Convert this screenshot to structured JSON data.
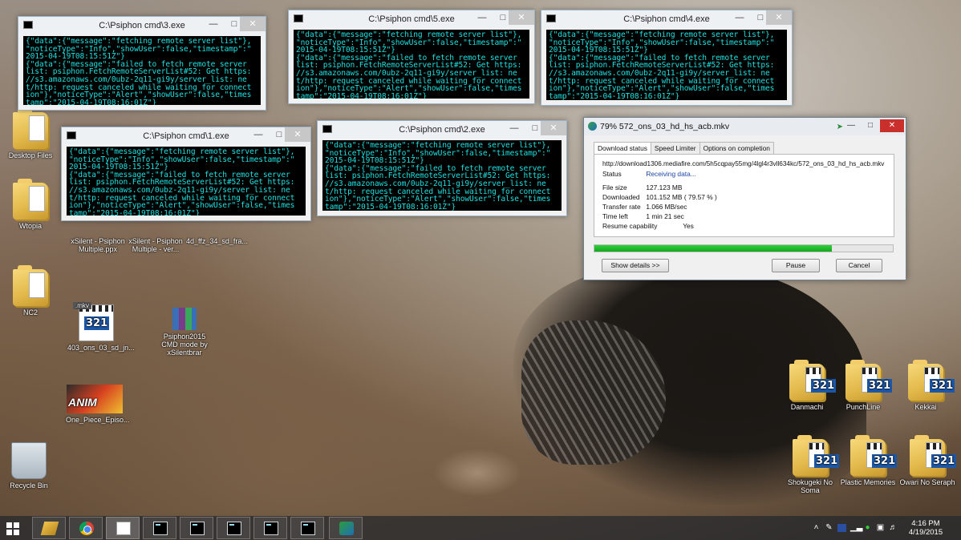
{
  "desktop": {
    "icons_left": [
      {
        "id": "desktop-files",
        "label": "Desktop Files",
        "type": "folder"
      },
      {
        "id": "wtopia",
        "label": "Wtopia",
        "type": "folder"
      },
      {
        "id": "nc2",
        "label": "NC2",
        "type": "folder"
      },
      {
        "id": "recycle-bin",
        "label": "Recycle Bin",
        "type": "recycle"
      },
      {
        "id": "mkv-file",
        "label": "403_ons_03_sd_jn...",
        "badge": ".mkv",
        "type": "mpc"
      },
      {
        "id": "psiphon-cmd",
        "label": "Psiphon2015 CMD mode by xSilentbrar",
        "type": "winrar"
      },
      {
        "id": "one-piece",
        "label": "One_Piece_Episo...",
        "type": "anim"
      },
      {
        "id": "xsilent-1",
        "label": "xSilent - Psiphon Multiple.ppx",
        "type": "exe"
      },
      {
        "id": "xsilent-2",
        "label": "xSilent - Psiphon Multiple - ver...",
        "type": "exe"
      },
      {
        "id": "file-4",
        "label": "4d_ffz_34_sd_fra...",
        "type": "mpc"
      }
    ],
    "icons_right": [
      {
        "id": "danmachi",
        "label": "Danmachi"
      },
      {
        "id": "punchline",
        "label": "PunchLine"
      },
      {
        "id": "kekkai",
        "label": "Kekkai"
      },
      {
        "id": "shokugeki",
        "label": "Shokugeki No Soma"
      },
      {
        "id": "plastic-memories",
        "label": "Plastic Memories"
      },
      {
        "id": "owari",
        "label": "Owari No Seraph"
      }
    ]
  },
  "consoles": [
    {
      "title": "C:\\Psiphon cmd\\3.exe",
      "lines": [
        "{\"data\":{\"message\":\"fetching remote server list\"},",
        "\"noticeType\":\"Info\",\"showUser\":false,\"timestamp\":\"",
        "2015-04-19T08:15:51Z\"}",
        "{\"data\":{\"message\":\"failed to fetch remote server",
        "list: psiphon.FetchRemoteServerList#52: Get https:",
        "//s3.amazonaws.com/0ubz-2q11-gi9y/server_list: ne",
        "t/http: request canceled while waiting for connect",
        "ion\"},\"noticeType\":\"Alert\",\"showUser\":false,\"times",
        "tamp\":\"2015-04-19T08:16:01Z\"}"
      ]
    },
    {
      "title": "C:\\Psiphon cmd\\5.exe",
      "lines": [
        "{\"data\":{\"message\":\"fetching remote server list\"},",
        "\"noticeType\":\"Info\",\"showUser\":false,\"timestamp\":\"",
        "2015-04-19T08:15:51Z\"}",
        "{\"data\":{\"message\":\"failed to fetch remote server",
        "list: psiphon.FetchRemoteServerList#52: Get https:",
        "//s3.amazonaws.com/0ubz-2q11-gi9y/server_list: ne",
        "t/http: request canceled while waiting for connect",
        "ion\"},\"noticeType\":\"Alert\",\"showUser\":false,\"times",
        "tamp\":\"2015-04-19T08:16:01Z\"}"
      ]
    },
    {
      "title": "C:\\Psiphon cmd\\4.exe",
      "lines": [
        "{\"data\":{\"message\":\"fetching remote server list\"},",
        "\"noticeType\":\"Info\",\"showUser\":false,\"timestamp\":\"",
        "2015-04-19T08:15:51Z\"}",
        "{\"data\":{\"message\":\"failed to fetch remote server",
        "list: psiphon.FetchRemoteServerList#52: Get https:",
        "//s3.amazonaws.com/0ubz-2q11-gi9y/server_list: ne",
        "t/http: request canceled while waiting for connect",
        "ion\"},\"noticeType\":\"Alert\",\"showUser\":false,\"times",
        "tamp\":\"2015-04-19T08:16:01Z\"}"
      ]
    },
    {
      "title": "C:\\Psiphon cmd\\1.exe",
      "lines": [
        "{\"data\":{\"message\":\"fetching remote server list\"},",
        "\"noticeType\":\"Info\",\"showUser\":false,\"timestamp\":\"",
        "2015-04-19T08:15:51Z\"}",
        "{\"data\":{\"message\":\"failed to fetch remote server",
        "list: psiphon.FetchRemoteServerList#52: Get https:",
        "//s3.amazonaws.com/0ubz-2q11-gi9y/server_list: ne",
        "t/http: request canceled while waiting for connect",
        "ion\"},\"noticeType\":\"Alert\",\"showUser\":false,\"times",
        "tamp\":\"2015-04-19T08:16:01Z\"}"
      ]
    },
    {
      "title": "C:\\Psiphon cmd\\2.exe",
      "lines": [
        "{\"data\":{\"message\":\"fetching remote server list\"},",
        "\"noticeType\":\"Info\",\"showUser\":false,\"timestamp\":\"",
        "2015-04-19T08:15:51Z\"}",
        "{\"data\":{\"message\":\"failed to fetch remote server",
        "list: psiphon.FetchRemoteServerList#52: Get https:",
        "//s3.amazonaws.com/0ubz-2q11-gi9y/server_list: ne",
        "t/http: request canceled while waiting for connect",
        "ion\"},\"noticeType\":\"Alert\",\"showUser\":false,\"times",
        "tamp\":\"2015-04-19T08:16:01Z\"}"
      ]
    }
  ],
  "download": {
    "title": "79% 572_ons_03_hd_hs_acb.mkv",
    "tabs": [
      "Download status",
      "Speed Limiter",
      "Options on completion"
    ],
    "url": "http://download1306.mediafire.com/5h5cqpay55mg/4lgl4r3vll634kc/572_ons_03_hd_hs_acb.mkv",
    "status_label": "Status",
    "status_value": "Receiving data...",
    "rows": [
      {
        "label": "File size",
        "value": "127.123  MB"
      },
      {
        "label": "Downloaded",
        "value": "101.152  MB  ( 79.57 % )"
      },
      {
        "label": "Transfer rate",
        "value": "1.066  MB/sec"
      },
      {
        "label": "Time left",
        "value": "1 min 21 sec"
      },
      {
        "label": "Resume capability",
        "value": "Yes"
      }
    ],
    "progress_percent": 79.57,
    "show_details_label": "Show details >>",
    "pause_label": "Pause",
    "cancel_label": "Cancel"
  },
  "taskbar": {
    "clock_time": "4:16 PM",
    "clock_date": "4/19/2015"
  },
  "colors": {
    "console_text": "#1fe0e0",
    "progress": "#20bb2a",
    "close_red": "#c9302c"
  }
}
